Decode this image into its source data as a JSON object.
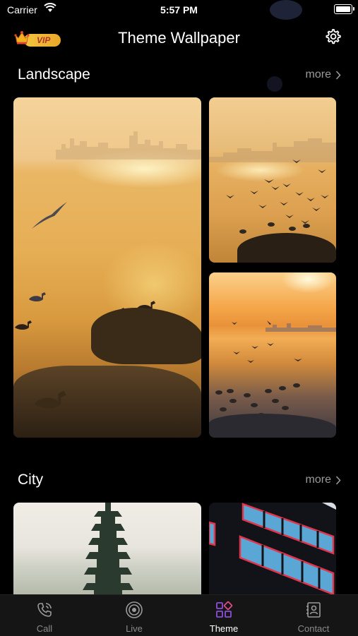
{
  "status_bar": {
    "carrier": "Carrier",
    "time": "5:57 PM"
  },
  "header": {
    "vip_label": "VIP",
    "title": "Theme Wallpaper",
    "settings_icon": "gear-icon"
  },
  "sections": [
    {
      "title": "Landscape",
      "more": "more"
    },
    {
      "title": "City",
      "more": "more"
    }
  ],
  "tabs": [
    {
      "label": "Call",
      "icon": "phone-icon",
      "active": false
    },
    {
      "label": "Live",
      "icon": "live-icon",
      "active": false
    },
    {
      "label": "Theme",
      "icon": "theme-grid-icon",
      "active": true
    },
    {
      "label": "Contact",
      "icon": "contact-card-icon",
      "active": false
    }
  ],
  "colors": {
    "accent": "#8a4fd8",
    "background": "#000000",
    "muted_text": "#9a9a9a",
    "vip_gold": "#f5c542"
  }
}
